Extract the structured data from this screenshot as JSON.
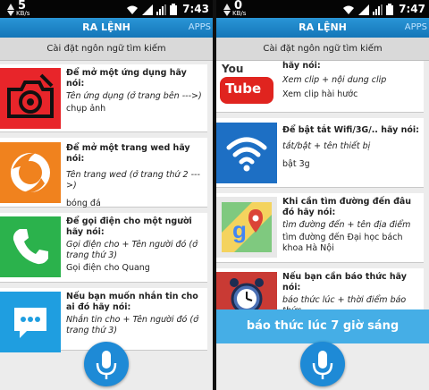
{
  "left": {
    "status": {
      "net_value": "5",
      "net_unit": "KB/s",
      "time": "7:43"
    },
    "title": "RA LỆNH",
    "apps_label": "APPS",
    "lang_button": "Cài đặt ngôn ngữ tìm kiếm",
    "cards": [
      {
        "icon": "camera-app-icon",
        "heading": "Để mở một ứng dụng hãy nói:",
        "hint": "Tên ứng dụng (ở trang bên --->)",
        "example": "chụp ảnh"
      },
      {
        "icon": "firefox-icon",
        "heading": "Để mở một trang wed hãy nói:",
        "hint": "Tên trang wed (ở trang thứ 2 --->)",
        "example": "bóng đá"
      },
      {
        "icon": "phone-call-icon",
        "heading": "Để gọi điện cho một người hãy nói:",
        "hint": "Gọi điện cho + Tên người đó (ở trang thứ 3)",
        "example": "Gọi điện cho Quang"
      },
      {
        "icon": "message-icon",
        "heading": "Nếu bạn muốn nhắn tin cho ai đó hãy nói:",
        "hint": "Nhắn tin cho + Tên người đó (ở trang thứ 3)",
        "example": ""
      }
    ]
  },
  "right": {
    "status": {
      "net_value": "0",
      "net_unit": "KB/s",
      "time": "7:47"
    },
    "title": "RA LỆNH",
    "apps_label": "APPS",
    "lang_button": "Cài đặt ngôn ngữ tìm kiếm",
    "cards": [
      {
        "icon": "youtube-icon",
        "heading": "hãy nói:",
        "hint": "Xem clip + nội dung clip",
        "example": "Xem clip hài hước",
        "logo_text": "You Tube"
      },
      {
        "icon": "wifi-icon",
        "heading": "Để bật tắt Wifi/3G/.. hãy nói:",
        "hint": "tắt/bật + tên thiết bị",
        "example": "bật 3g"
      },
      {
        "icon": "maps-icon",
        "heading": "Khi cần tìm đường đến đâu đó hãy nói:",
        "hint": "tìm đường đến + tên địa điểm",
        "example": "tìm đường đến Đại học bách khoa Hà Nội"
      },
      {
        "icon": "alarm-clock-icon",
        "heading": "Nếu bạn cần báo thức hãy nói:",
        "hint": "báo thức lúc + thời điểm báo thức",
        "example": ""
      }
    ],
    "recognized_text": "báo thức lúc 7 giờ sáng"
  },
  "colors": {
    "accent": "#1e8ad6",
    "banner": "#45aee6",
    "camera": "#e8252a",
    "firefox": "#f0821e",
    "phone": "#2bb24c",
    "message": "#1f9ee0",
    "youtube": "#e0241f",
    "wifi": "#1d6fc4",
    "maps": "#3cb371",
    "alarm": "#c93a34"
  }
}
